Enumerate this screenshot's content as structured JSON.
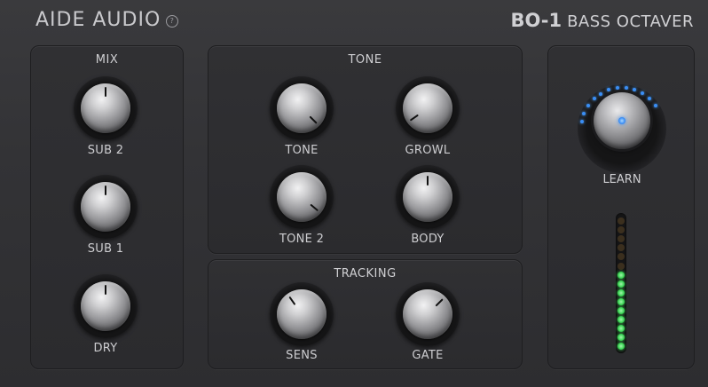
{
  "header": {
    "brand": "AIDE AUDIO",
    "info_icon_glyph": "?",
    "product_code": "BO-1",
    "product_name": "BASS OCTAVER"
  },
  "panels": {
    "mix": {
      "title": "MIX"
    },
    "tone": {
      "title": "TONE"
    },
    "tracking": {
      "title": "TRACKING"
    }
  },
  "knobs": {
    "sub2": {
      "label": "SUB 2",
      "angle_deg": 0
    },
    "sub1": {
      "label": "SUB 1",
      "angle_deg": 0
    },
    "dry": {
      "label": "DRY",
      "angle_deg": 0
    },
    "tone": {
      "label": "TONE",
      "angle_deg": 135
    },
    "growl": {
      "label": "GROWL",
      "angle_deg": -125
    },
    "tone2": {
      "label": "TONE 2",
      "angle_deg": 130
    },
    "body": {
      "label": "BODY",
      "angle_deg": 0
    },
    "sens": {
      "label": "SENS",
      "angle_deg": -35
    },
    "gate": {
      "label": "GATE",
      "angle_deg": 45
    }
  },
  "learn": {
    "label": "LEARN",
    "accent_color": "#3a8ef6",
    "ring_leds_lit": 12
  },
  "meter": {
    "total_leds": 15,
    "lit_leds": 9,
    "lit_color": "#39d353",
    "unlit_color": "#3b2f1e"
  }
}
